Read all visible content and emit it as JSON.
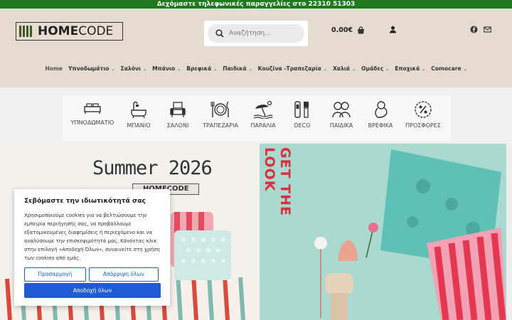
{
  "topbar": {
    "text": "Δεχόμαστε τηλεφωνικές παραγγελίες στο 22310 51303"
  },
  "header": {
    "logo_text_bold": "HOME",
    "logo_text_thin": "CODE",
    "search_placeholder": "Αναζήτηση...",
    "cart_total": "0.00€"
  },
  "nav": {
    "items": [
      {
        "label": "Home",
        "has_dropdown": false
      },
      {
        "label": "Υπνοδωμάτιο",
        "has_dropdown": true
      },
      {
        "label": "Σαλόνι",
        "has_dropdown": true
      },
      {
        "label": "Μπάνιο",
        "has_dropdown": true
      },
      {
        "label": "Βρεφικά",
        "has_dropdown": true
      },
      {
        "label": "Παιδικά",
        "has_dropdown": true
      },
      {
        "label": "Κουζίνα -Τραπεζαρία",
        "has_dropdown": true
      },
      {
        "label": "Χαλιά",
        "has_dropdown": true
      },
      {
        "label": "Ομάδες",
        "has_dropdown": true
      },
      {
        "label": "Εποχικά",
        "has_dropdown": true
      },
      {
        "label": "Comocare",
        "has_dropdown": true
      }
    ]
  },
  "categories": [
    {
      "label": "ΥΠΝΟΔΩΜΑΤΙΟ",
      "icon": "bed-icon"
    },
    {
      "label": "ΜΠΑΝΙΟ",
      "icon": "bathtub-icon"
    },
    {
      "label": "ΣΑΛΟΝΙ",
      "icon": "sofa-icon"
    },
    {
      "label": "ΤΡΑΠΕΖΑΡΙΑ",
      "icon": "plate-cutlery-icon"
    },
    {
      "label": "ΠΑΡΑΛΙΑ",
      "icon": "beach-umbrella-icon"
    },
    {
      "label": "DECO",
      "icon": "deco-icon"
    },
    {
      "label": "ΠΑΙΔΙΚΑ",
      "icon": "kids-icon"
    },
    {
      "label": "ΒΡΕΦΙΚΑ",
      "icon": "baby-icon"
    },
    {
      "label": "ΠΡΟΣΦΟΡΕΣ",
      "icon": "percent-badge-icon"
    }
  ],
  "hero": {
    "title": "Summer 2026",
    "logo_text": "HOMECODE",
    "vertical_text": "GET THE LOOK"
  },
  "cookie": {
    "title": "Σεβόμαστε την ιδιωτικότητά σας",
    "body": "Χρησιμοποιούμε cookies για να βελτιώσουμε την εμπειρία περιήγησής σας, να προβάλλουμε εξατομικευμένες διαφημίσεις ή περιεχόμενο και να αναλύσουμε την επισκεψιμότητά μας. Κάνοντας κλικ στην επιλογή «Αποδοχή Όλων», συναινείτε στη χρήση των cookies από εμάς.",
    "customize_label": "Προσαρμογή",
    "reject_label": "Απόρριψη όλων",
    "accept_label": "Αποδοχή όλων"
  },
  "colors": {
    "topbar_bg": "#1f7a1f",
    "header_bg": "#e5dbcf",
    "accent_blue": "#1e5bd6",
    "hero_red": "#d8303d"
  }
}
